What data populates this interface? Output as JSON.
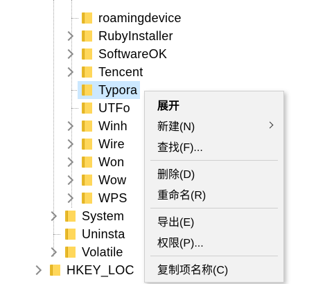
{
  "tree": {
    "items": [
      {
        "label": "roamingdevice"
      },
      {
        "label": "RubyInstaller"
      },
      {
        "label": "SoftwareOK"
      },
      {
        "label": "Tencent"
      },
      {
        "label": "Typora"
      },
      {
        "label": "UTFo"
      },
      {
        "label": "Winh"
      },
      {
        "label": "Wire"
      },
      {
        "label": "Won"
      },
      {
        "label": "Wow"
      },
      {
        "label": "WPS"
      },
      {
        "label": "System"
      },
      {
        "label": "Uninsta"
      },
      {
        "label": "Volatile"
      },
      {
        "label": "HKEY_LOC"
      }
    ]
  },
  "context_menu": {
    "expand": "展开",
    "new": "新建(N)",
    "find": "查找(F)...",
    "delete": "删除(D)",
    "rename": "重命名(R)",
    "export": "导出(E)",
    "permissions": "权限(P)...",
    "copy_key_name": "复制项名称(C)"
  }
}
